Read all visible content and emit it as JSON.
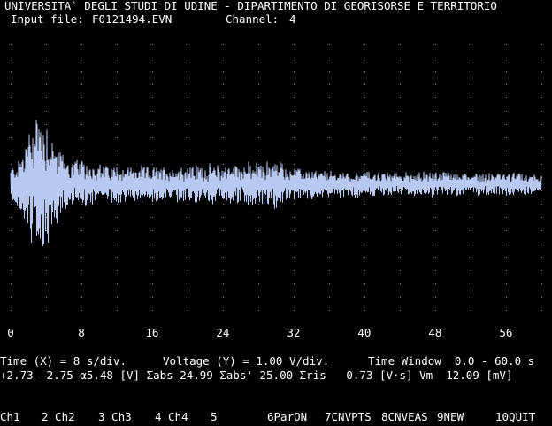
{
  "header": {
    "title": "UNIVERSITA` DEGLI STUDI DI UDINE - DIPARTIMENTO DI GEORISORSE E TERRITORIO",
    "input_file_label": "Input file:",
    "input_file": "F0121494.EVN",
    "channel_label": "Channel:",
    "channel": "4"
  },
  "colors": {
    "background": "#000000",
    "trace": "#b8c8f0",
    "text": "#ffffff",
    "grid": "#8a8a8a"
  },
  "axis": {
    "ticks": [
      "0",
      "8",
      "16",
      "24",
      "32",
      "40",
      "48",
      "56"
    ]
  },
  "status": {
    "line1_time": "Time (X) = 8 s/div.",
    "line1_voltage": "Voltage (Y) = 1.00 V/div.",
    "line1_window": "Time Window  0.0 - 60.0 s",
    "line2": "+2.73 -2.75 α5.48 [V] Σabs 24.99 Σabs' 25.00 Σris   0.73 [V·s] Vm  12.09 [mV]"
  },
  "function_keys": [
    {
      "label": "Ch1"
    },
    {
      "label": "2 Ch2"
    },
    {
      "label": "3 Ch3"
    },
    {
      "label": "4 Ch4"
    },
    {
      "label": "5"
    },
    {
      "label": "6ParON"
    },
    {
      "label": "7CNVPTS"
    },
    {
      "label": "8CNVEAS"
    },
    {
      "label": "9NEW"
    },
    {
      "label": "10QUIT"
    }
  ],
  "chart_data": {
    "type": "line",
    "xlim": [
      0,
      60
    ],
    "ylim": [
      -3,
      3
    ],
    "x_unit": "s",
    "y_unit": "V",
    "grid": true,
    "envelope": {
      "x": [
        0,
        1,
        2,
        3,
        4,
        5,
        6,
        8,
        10,
        12,
        16,
        20,
        24,
        28,
        30,
        32,
        36,
        40,
        44,
        48,
        52,
        56,
        60
      ],
      "amplitude": [
        0.6,
        0.9,
        1.8,
        2.75,
        2.3,
        1.6,
        1.0,
        0.8,
        0.7,
        0.65,
        0.6,
        0.65,
        0.7,
        0.75,
        0.85,
        0.55,
        0.45,
        0.45,
        0.4,
        0.45,
        0.4,
        0.4,
        0.35
      ]
    },
    "samples": 1200
  }
}
